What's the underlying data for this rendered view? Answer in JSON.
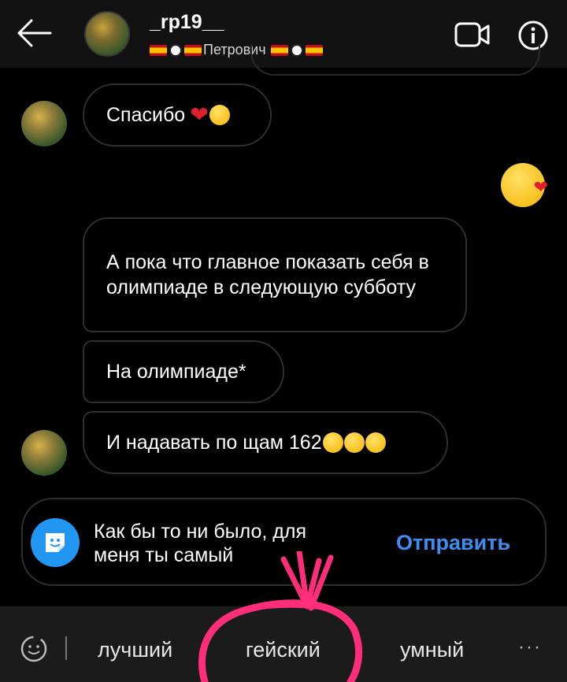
{
  "header": {
    "username": "_rp19__",
    "subtitle_name": "Петрович"
  },
  "messages": [
    {
      "text": "Спасибо",
      "emoji": "heart-kiss"
    },
    {
      "text": "А пока что главное показать себя в олимпиаде в следующую субботу"
    },
    {
      "text": "На олимпиаде*"
    },
    {
      "text": "И надавать по щам 162",
      "emoji": "laughing-x3"
    }
  ],
  "suggestion": {
    "text": "Как бы то ни было, для меня ты самый",
    "send_label": "Отправить"
  },
  "keyboard": {
    "words": [
      "лучший",
      "гейский",
      "умный"
    ],
    "more": "···"
  },
  "colors": {
    "accent": "#3b8ff0",
    "header_bg": "#121212",
    "bubble_border": "#2f2f2f",
    "annotation": "#ff2d7a"
  }
}
